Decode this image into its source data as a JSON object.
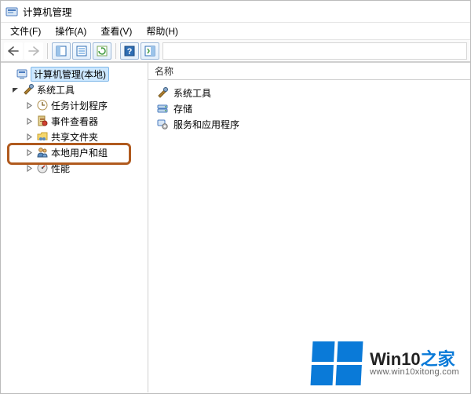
{
  "title": "计算机管理",
  "menu": {
    "file": "文件(F)",
    "action": "操作(A)",
    "view": "查看(V)",
    "help": "帮助(H)"
  },
  "tree": {
    "root": "计算机管理(本地)",
    "sys_tools": "系统工具",
    "task_scheduler": "任务计划程序",
    "event_viewer": "事件查看器",
    "shared_folders": "共享文件夹",
    "local_users_groups": "本地用户和组",
    "performance": "性能"
  },
  "list": {
    "header": "名称",
    "items": {
      "sys_tools": "系统工具",
      "storage": "存储",
      "services_apps": "服务和应用程序"
    }
  },
  "watermark": {
    "brand_prefix": "Win10",
    "brand_suffix": "之家",
    "url": "www.win10xitong.com"
  }
}
